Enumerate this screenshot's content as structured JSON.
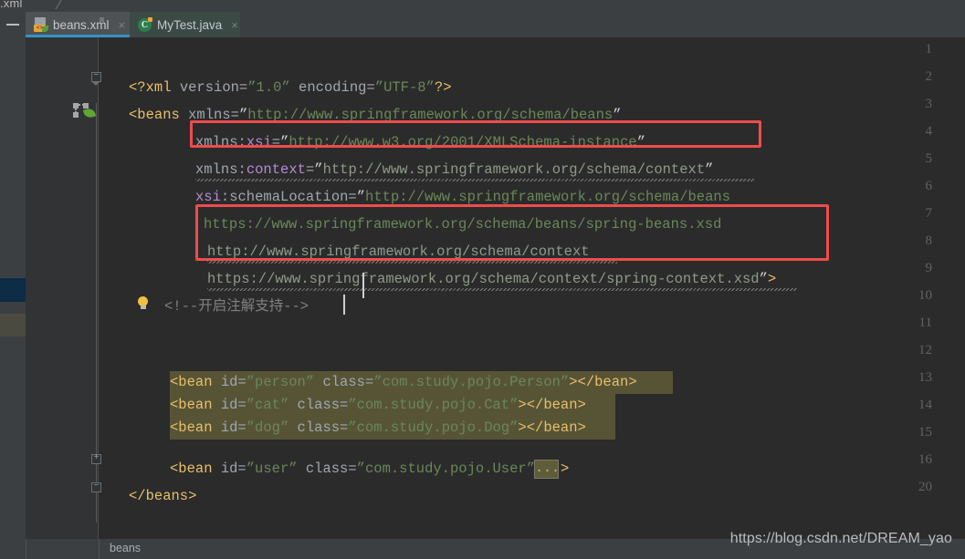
{
  "window": {
    "top_breadcrumb": ".xml",
    "minimize_label": "—"
  },
  "tabs": [
    {
      "label": "beans.xml",
      "icon": "xml-file-icon",
      "close": "×",
      "active": true
    },
    {
      "label": "MyTest.java",
      "icon": "java-class-icon",
      "close": "×",
      "active": false
    }
  ],
  "gutter": {
    "line_numbers": [
      "1",
      "2",
      "3",
      "4",
      "5",
      "6",
      "7",
      "8",
      "9",
      "10",
      "11",
      "12",
      "13",
      "14",
      "15",
      "16",
      "20"
    ],
    "spring_bean_icon": "spring-bean-icon",
    "leaf_icon": "spring-leaf-icon",
    "bulb_icon": "intention-bulb-icon",
    "fold_collapsed_sign": "+",
    "fold_expanded_sign": "−"
  },
  "code": {
    "line1": {
      "p1": "<?",
      "p2": "xml",
      "p3": " version=",
      "p4": "”1.0”",
      "p5": " encoding=",
      "p6": "”UTF-8”",
      "p7": "?>"
    },
    "line2": {
      "tag": "<beans",
      "attr": " xmlns=",
      "q1": "”",
      "val": "http://www.springframework.org/schema/beans",
      "q2": "”"
    },
    "line3": {
      "attr": "xmlns:",
      "ns": "xsi",
      "eq": "=",
      "q1": "”",
      "val": "http://www.w3.org/2001/XMLSchema-instance",
      "q2": "”"
    },
    "line4": {
      "attr": "xmlns:",
      "ns": "context",
      "eq": "=",
      "q1": "”",
      "val": "http://www.springframework.org/schema/context",
      "q2": "”"
    },
    "line5": {
      "ns": "xsi",
      "attr": ":schemaLocation=",
      "q1": "”",
      "val": "http://www.springframework.org/schema/beans"
    },
    "line6": {
      "val": "https://www.springframework.org/schema/beans/spring-beans.xsd"
    },
    "line7": {
      "val": "http://www.springframework.org/schema/context"
    },
    "line8": {
      "val": "https://www.springframework.org/schema/context/spring-context.xsd",
      "q2": "”",
      "close": ">"
    },
    "line9": {
      "comment": "<!--开启注解支持-->"
    },
    "line12": {
      "open": "<bean",
      "a1": " id=",
      "v1": "”person”",
      "a2": " class=",
      "v2": "”com.study.pojo.Person”",
      "gt": ">",
      "close": "</bean>"
    },
    "line13": {
      "open": "<bean",
      "a1": " id=",
      "v1": "”cat”",
      "a2": " class=",
      "v2": "”com.study.pojo.Cat”",
      "gt": ">",
      "close": "</bean>"
    },
    "line14": {
      "open": "<bean",
      "a1": " id=",
      "v1": "”dog”",
      "a2": " class=",
      "v2": "”com.study.pojo.Dog”",
      "gt": ">",
      "close": "</bean>"
    },
    "line16": {
      "open": "<bean",
      "a1": " id=",
      "v1": "”user”",
      "a2": " class=",
      "v2": "”com.study.pojo.User”",
      "folded": "...",
      "gt": ">"
    },
    "line20": {
      "close": "</beans>"
    }
  },
  "annotations": {
    "red_box_1": "xmlns:context declaration highlight",
    "red_box_2": "context schemaLocation entries highlight"
  },
  "status": {
    "breadcrumb": "beans",
    "watermark": "https://blog.csdn.net/DREAM_yao"
  },
  "colors": {
    "accent": "#3592c4",
    "highlight_box": "#f04b4b",
    "selection": "#5f5c38",
    "tag": "#e8bf6a",
    "value": "#6a8759",
    "namespace": "#b58ad6",
    "editor_bg": "#2b2b2b",
    "gutter_bg": "#313335",
    "chrome_bg": "#3c3f41"
  }
}
